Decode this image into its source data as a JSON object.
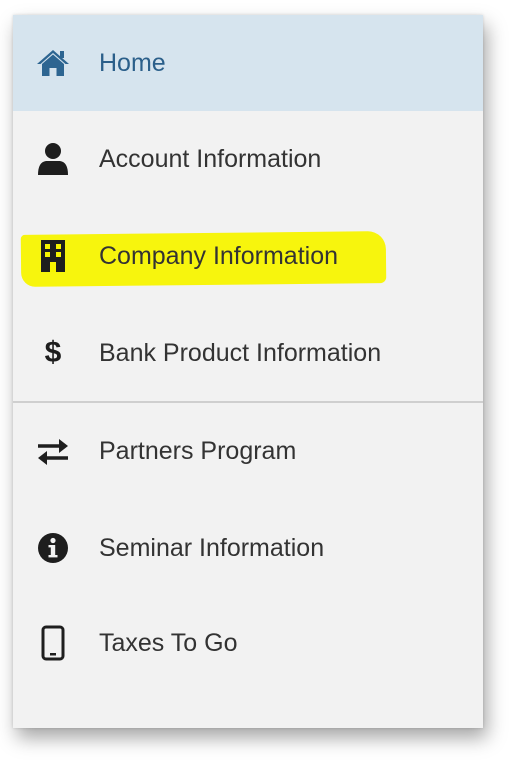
{
  "menu": {
    "items": [
      {
        "label": "Home",
        "icon": "home-icon"
      },
      {
        "label": "Account Information",
        "icon": "user-icon"
      },
      {
        "label": "Company Information",
        "icon": "building-icon"
      },
      {
        "label": "Bank Product Information",
        "icon": "dollar-icon",
        "symbol": "$"
      },
      {
        "label": "Partners Program",
        "icon": "exchange-icon"
      },
      {
        "label": "Seminar Information",
        "icon": "info-circle-icon"
      },
      {
        "label": "Taxes To Go",
        "icon": "mobile-icon"
      }
    ]
  },
  "colors": {
    "active_background": "#d6e4ee",
    "active_text": "#2b5f8a",
    "highlight": "#f7f400"
  }
}
